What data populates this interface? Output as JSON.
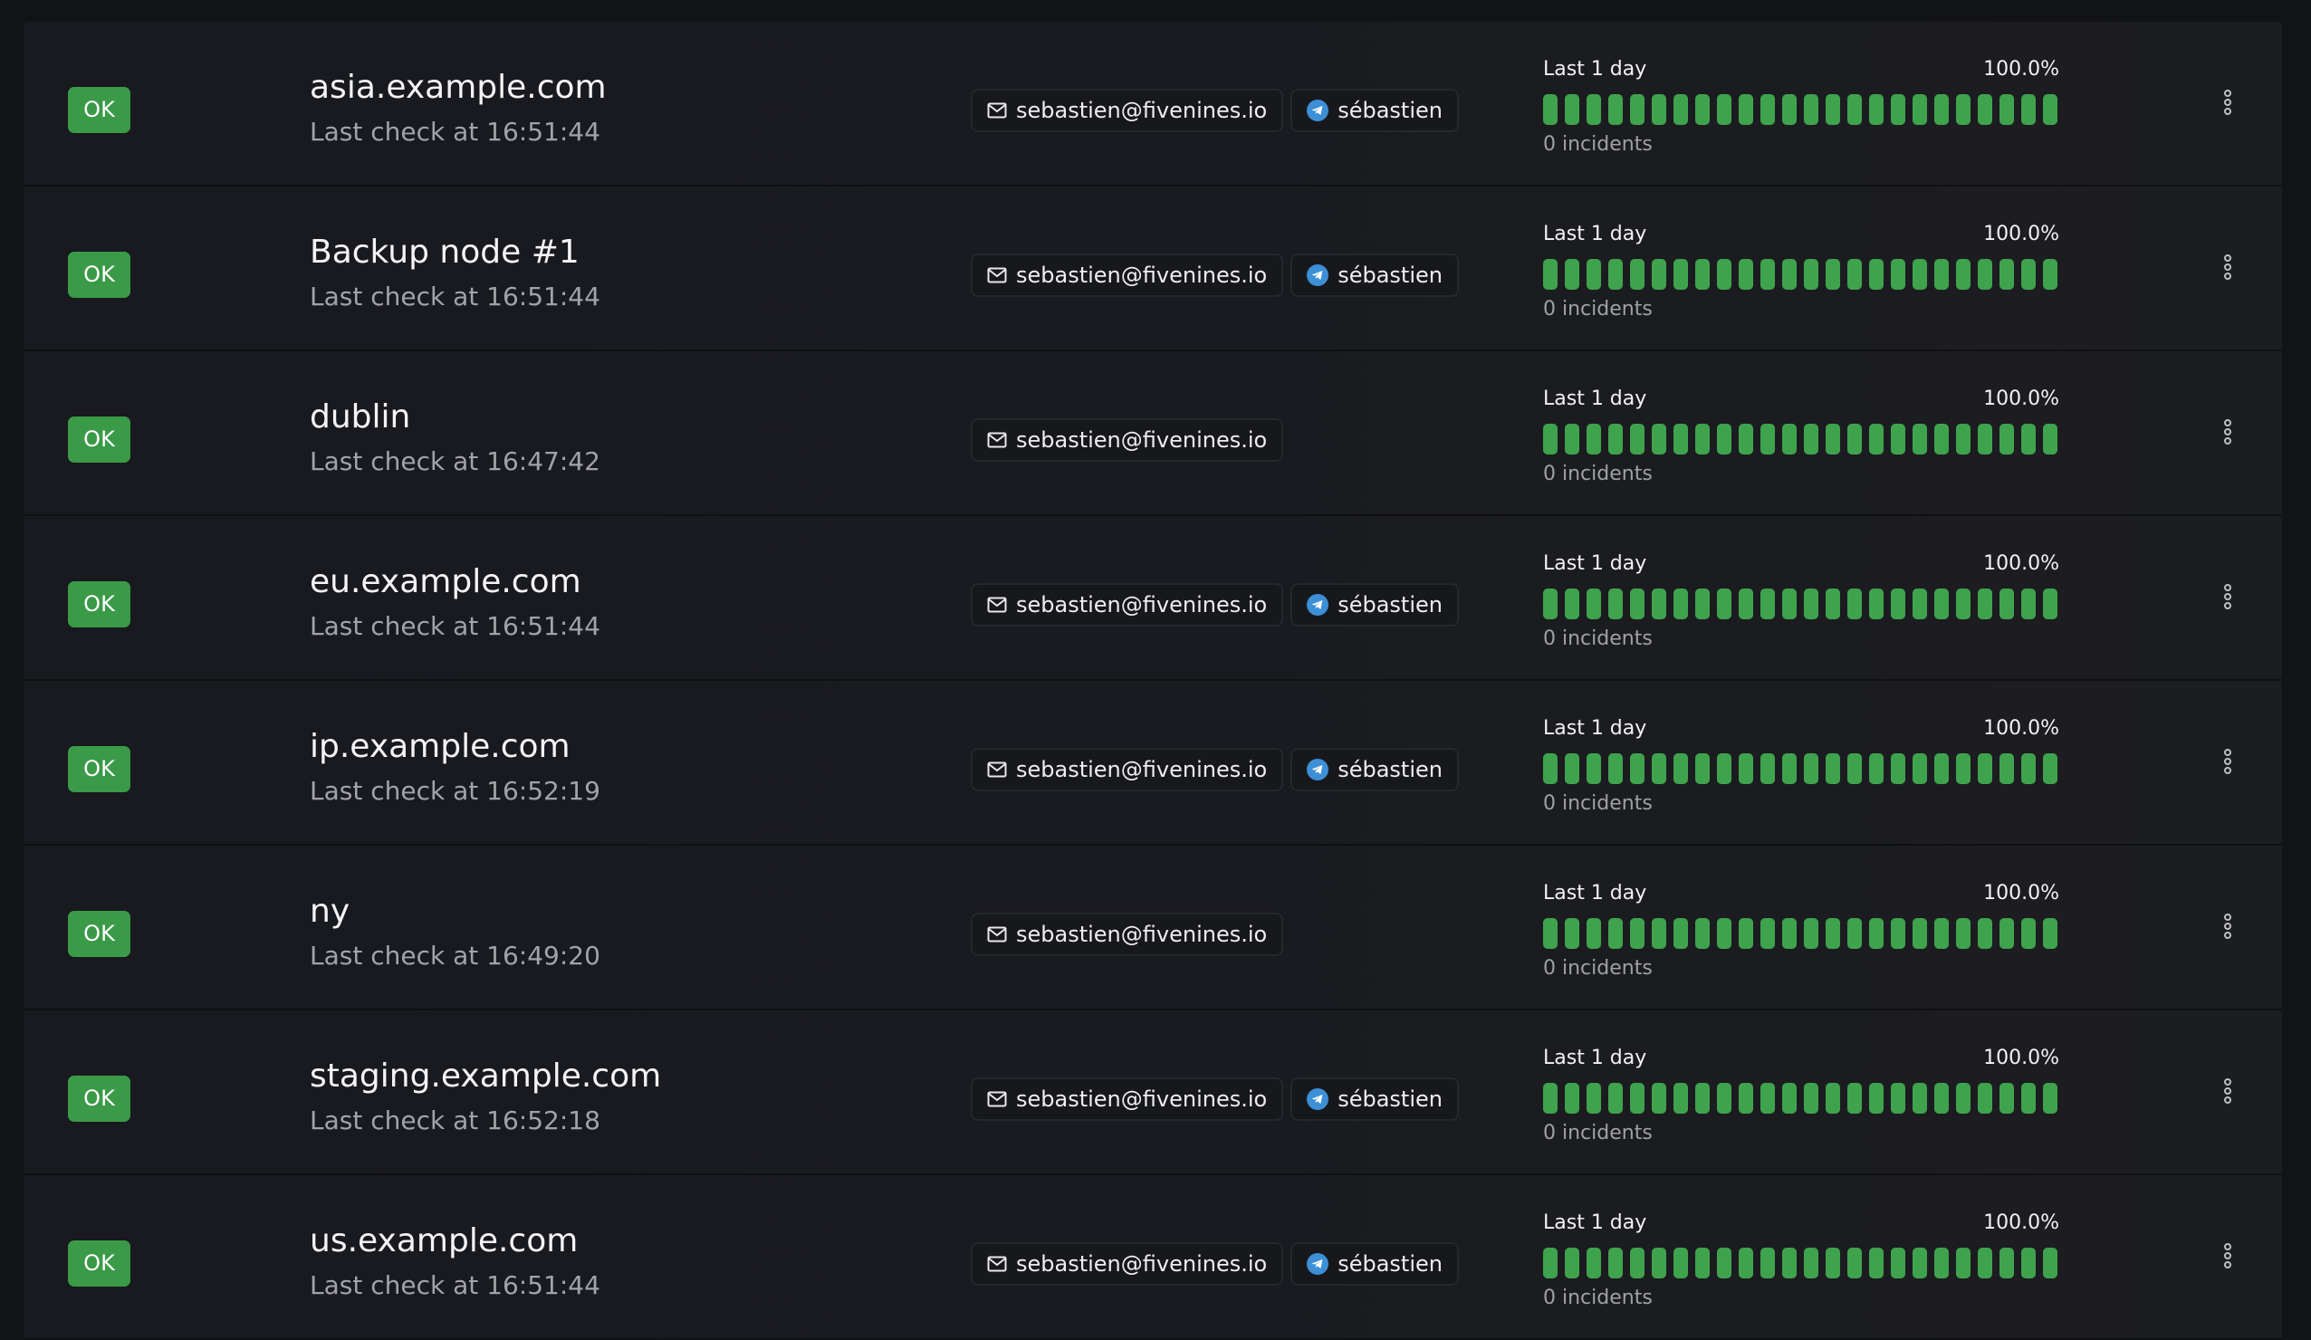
{
  "colors": {
    "background": "#121315",
    "row_bg": "#1a1b20",
    "ok_badge": "#3a9a47",
    "uptime_bar": "#3fa34d",
    "telegram_blue": "#3d8fd6"
  },
  "icons": {
    "email": "envelope-icon",
    "telegram": "telegram-icon",
    "menu": "vertical-dots-menu-icon"
  },
  "monitors": [
    {
      "status": "OK",
      "name": "asia.example.com",
      "last_check": "Last check at 16:51:44",
      "email": "sebastien@fivenines.io",
      "telegram": "sébastien",
      "uptime_period": "Last 1 day",
      "uptime_percent": "100.0%",
      "incidents": "0 incidents"
    },
    {
      "status": "OK",
      "name": "Backup node #1",
      "last_check": "Last check at 16:51:44",
      "email": "sebastien@fivenines.io",
      "telegram": "sébastien",
      "uptime_period": "Last 1 day",
      "uptime_percent": "100.0%",
      "incidents": "0 incidents"
    },
    {
      "status": "OK",
      "name": "dublin",
      "last_check": "Last check at 16:47:42",
      "email": "sebastien@fivenines.io",
      "telegram": null,
      "uptime_period": "Last 1 day",
      "uptime_percent": "100.0%",
      "incidents": "0 incidents"
    },
    {
      "status": "OK",
      "name": "eu.example.com",
      "last_check": "Last check at 16:51:44",
      "email": "sebastien@fivenines.io",
      "telegram": "sébastien",
      "uptime_period": "Last 1 day",
      "uptime_percent": "100.0%",
      "incidents": "0 incidents"
    },
    {
      "status": "OK",
      "name": "ip.example.com",
      "last_check": "Last check at 16:52:19",
      "email": "sebastien@fivenines.io",
      "telegram": "sébastien",
      "uptime_period": "Last 1 day",
      "uptime_percent": "100.0%",
      "incidents": "0 incidents"
    },
    {
      "status": "OK",
      "name": "ny",
      "last_check": "Last check at 16:49:20",
      "email": "sebastien@fivenines.io",
      "telegram": null,
      "uptime_period": "Last 1 day",
      "uptime_percent": "100.0%",
      "incidents": "0 incidents"
    },
    {
      "status": "OK",
      "name": "staging.example.com",
      "last_check": "Last check at 16:52:18",
      "email": "sebastien@fivenines.io",
      "telegram": "sébastien",
      "uptime_period": "Last 1 day",
      "uptime_percent": "100.0%",
      "incidents": "0 incidents"
    },
    {
      "status": "OK",
      "name": "us.example.com",
      "last_check": "Last check at 16:51:44",
      "email": "sebastien@fivenines.io",
      "telegram": "sébastien",
      "uptime_period": "Last 1 day",
      "uptime_percent": "100.0%",
      "incidents": "0 incidents"
    }
  ]
}
